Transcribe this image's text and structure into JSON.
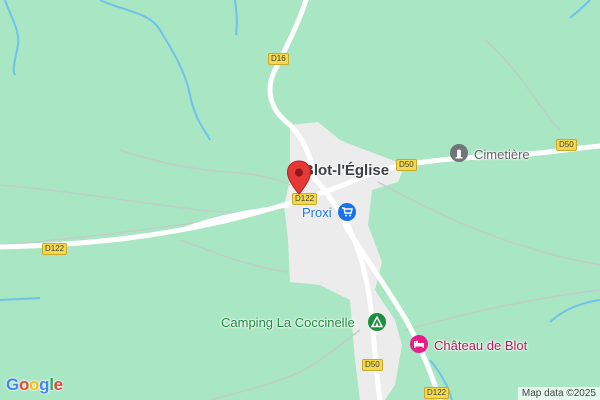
{
  "map": {
    "places": {
      "town": "Blot-l'Église",
      "store": "Proxi",
      "cemetery": "Cimetière",
      "camping": "Camping La Coccinelle",
      "castle": "Château de Blot"
    },
    "roads": {
      "d16": "D16",
      "d122_west": "D122",
      "d122_pin": "D122",
      "d50_town": "D50",
      "d50_east": "D50",
      "d50_south": "D50",
      "d122_south": "D122"
    },
    "attribution": "Map data ©2025",
    "logo": {
      "letters": [
        "G",
        "o",
        "o",
        "g",
        "l",
        "e"
      ],
      "colors": [
        "#4285F4",
        "#EA4335",
        "#FBBC05",
        "#4285F4",
        "#34A853",
        "#EA4335"
      ]
    }
  },
  "colors": {
    "land": "#a8e6c4",
    "urban": "#ececec",
    "water": "#6fc3ea",
    "pin": "#e53935",
    "store_icon": "#1a73e8",
    "poi_text_blue": "#1a73e8",
    "camping_icon": "#1e8e3e",
    "castle_icon": "#e91e8c",
    "castle_text": "#c2185b",
    "cemetery_icon": "#70757a"
  }
}
